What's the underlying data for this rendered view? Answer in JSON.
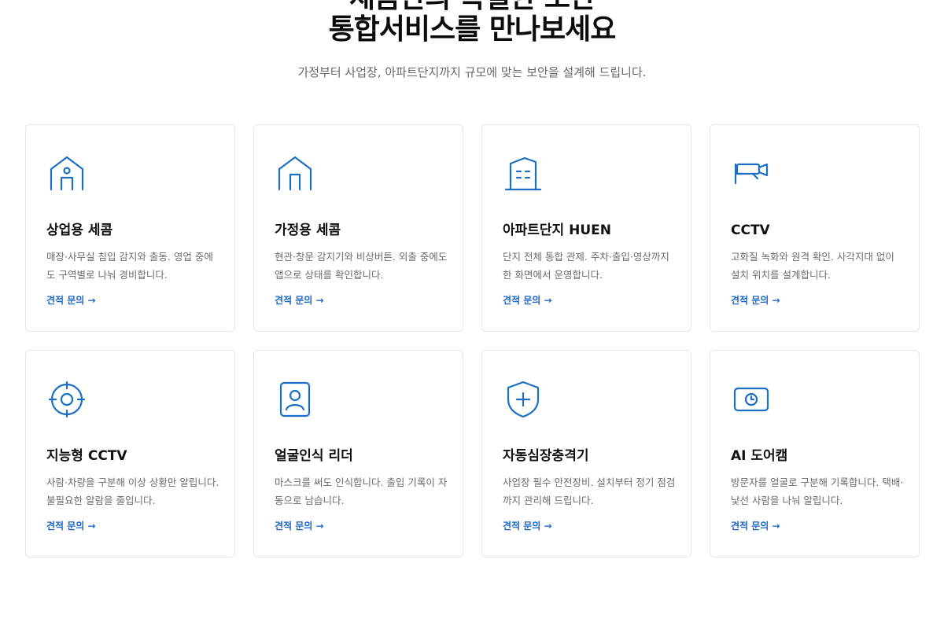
{
  "heading": {
    "line1": "세콤만의 특별한 보안",
    "line2": "통합서비스를 만나보세요",
    "subtitle": "가정부터 사업장, 아파트단지까지 규모에 맞는 보안을 설계해 드립니다."
  },
  "colors": {
    "accent": "#1d6fc4",
    "link": "#1d66c9",
    "border": "#e3e6ea",
    "muted": "#6b6b6b"
  },
  "cards": [
    {
      "icon": "store-person-icon",
      "title": "상업용 세콤",
      "desc": "매장·사무실 침입 감지와 출동. 영업 중에도 구역별로 나눠 경비합니다.",
      "link": "견적 문의 →"
    },
    {
      "icon": "house-icon",
      "title": "가정용 세콤",
      "desc": "현관·창문 감지기와 비상버튼. 외출 중에도 앱으로 상태를 확인합니다.",
      "link": "견적 문의 →"
    },
    {
      "icon": "apartment-building-icon",
      "title": "아파트단지 HUEN",
      "desc": "단지 전체 통합 관제. 주차·출입·영상까지 한 화면에서 운영합니다.",
      "link": "견적 문의 →"
    },
    {
      "icon": "cctv-camera-icon",
      "title": "CCTV",
      "desc": "고화질 녹화와 원격 확인. 사각지대 없이 설치 위치를 설계합니다.",
      "link": "견적 문의 →"
    },
    {
      "icon": "target-crosshair-icon",
      "title": "지능형 CCTV",
      "desc": "사람·차량을 구분해 이상 상황만 알립니다. 불필요한 알람을 줄입니다.",
      "link": "견적 문의 →"
    },
    {
      "icon": "face-id-icon",
      "title": "얼굴인식 리더",
      "desc": "마스크를 써도 인식합니다. 출입 기록이 자동으로 남습니다.",
      "link": "견적 문의 →"
    },
    {
      "icon": "shield-plus-icon",
      "title": "자동심장충격기",
      "desc": "사업장 필수 안전장비. 설치부터 정기 점검까지 관리해 드립니다.",
      "link": "견적 문의 →"
    },
    {
      "icon": "door-camera-icon",
      "title": "AI 도어캠",
      "desc": "방문자를 얼굴로 구분해 기록합니다. 택배·낯선 사람을 나눠 알립니다.",
      "link": "견적 문의 →"
    }
  ]
}
